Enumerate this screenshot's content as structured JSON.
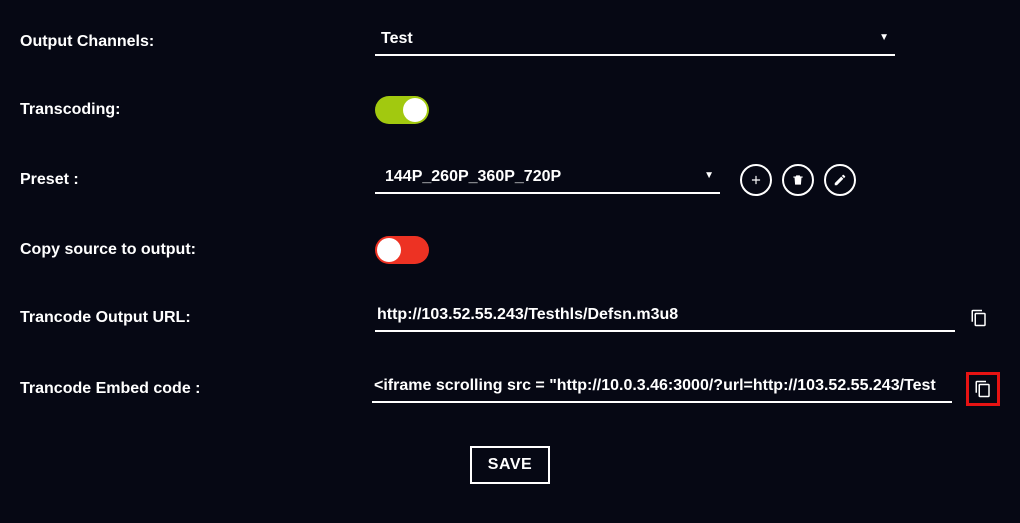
{
  "labels": {
    "outputChannels": "Output Channels:",
    "transcoding": "Transcoding:",
    "preset": "Preset :",
    "copySource": "Copy source to output:",
    "transcodeUrl": "Trancode Output URL:",
    "transcodeEmbed": "Trancode Embed code :"
  },
  "fields": {
    "outputChannel": "Test",
    "preset": "144P_260P_360P_720P",
    "transcodeUrl": "http://103.52.55.243/Testhls/Defsn.m3u8",
    "transcodeEmbed": "<iframe scrolling src = \"http://10.0.3.46:3000/?url=http://103.52.55.243/Test"
  },
  "toggles": {
    "transcoding": true,
    "copySource": true
  },
  "buttons": {
    "save": "SAVE"
  }
}
